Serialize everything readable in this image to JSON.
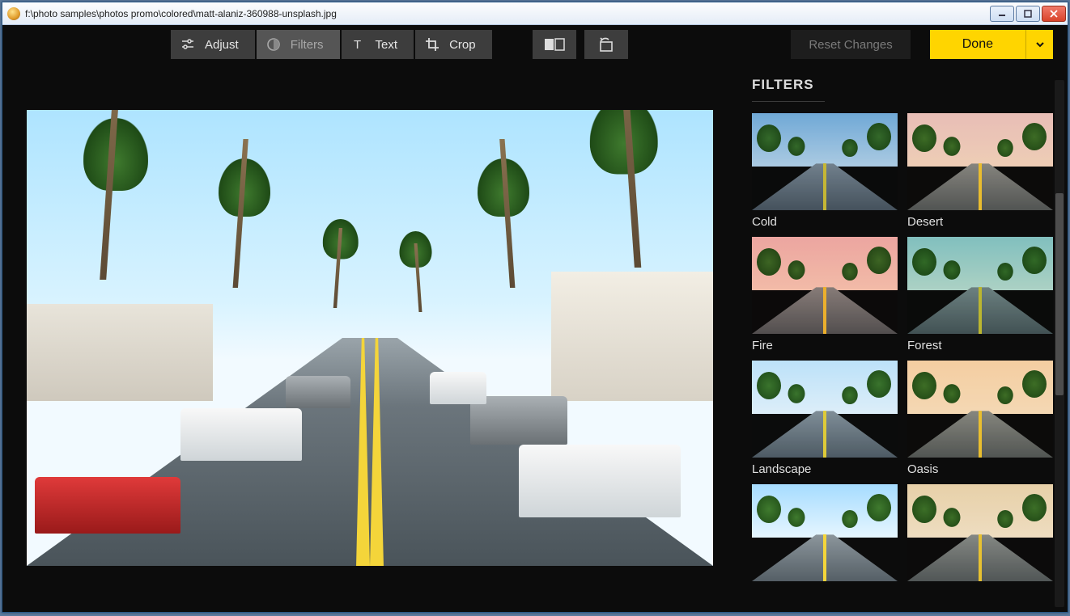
{
  "window": {
    "title": "f:\\photo samples\\photos promo\\colored\\matt-alaniz-360988-unsplash.jpg"
  },
  "toolbar": {
    "adjust": "Adjust",
    "filters": "Filters",
    "text": "Text",
    "crop": "Crop",
    "reset": "Reset Changes",
    "done": "Done"
  },
  "sidebar": {
    "title": "FILTERS",
    "filters": [
      {
        "name": "Cold",
        "sky": "linear-gradient(#8ac5ee,#d4edfb)",
        "tint": "#3a6a9a",
        "op": 0.25
      },
      {
        "name": "Desert",
        "sky": "linear-gradient(#f3d7e2,#f9e9e0)",
        "tint": "#d99a5a",
        "op": 0.3
      },
      {
        "name": "Fire",
        "sky": "linear-gradient(#f5c9d0,#fbe3da)",
        "tint": "#e06a3a",
        "op": 0.3
      },
      {
        "name": "Forest",
        "sky": "linear-gradient(#a8e0e8,#e0f5ef)",
        "tint": "#2a7a5a",
        "op": 0.28
      },
      {
        "name": "Landscape",
        "sky": "linear-gradient(#cfeeff,#f3fbff)",
        "tint": "#88bde0",
        "op": 0.2
      },
      {
        "name": "Oasis",
        "sky": "linear-gradient(#ffe6c8,#fff2de)",
        "tint": "#d9a45a",
        "op": 0.3
      },
      {
        "name": "",
        "sky": "linear-gradient(#a6dcff,#e6f6ff)",
        "tint": "#ffffff",
        "op": 0.0
      },
      {
        "name": "",
        "sky": "linear-gradient(#f4e6c8,#fbf4e4)",
        "tint": "#c9a060",
        "op": 0.25
      }
    ]
  },
  "colors": {
    "accent": "#ffd500",
    "bg": "#0c0c0c",
    "button": "#3d3d3d"
  }
}
